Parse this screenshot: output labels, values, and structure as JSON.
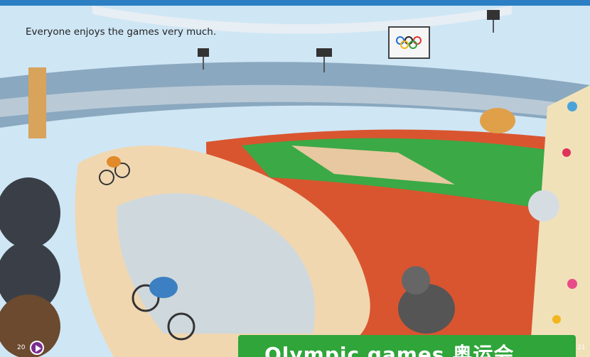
{
  "caption": "Everyone enjoys the games very much.",
  "page_left": "20",
  "page_right": "21",
  "banner_title": "Olympic games 奥运会",
  "icons": {
    "play": "play-icon",
    "olympic_rings": "olympic-rings-icon"
  },
  "colors": {
    "sky": "#cfe6f5",
    "track": "#d9552f",
    "grass": "#3aa946",
    "velodrome": "#f0d7b0",
    "banner": "#2fa53a",
    "frame": "#2b7fc2",
    "play": "#7a2c8f"
  }
}
